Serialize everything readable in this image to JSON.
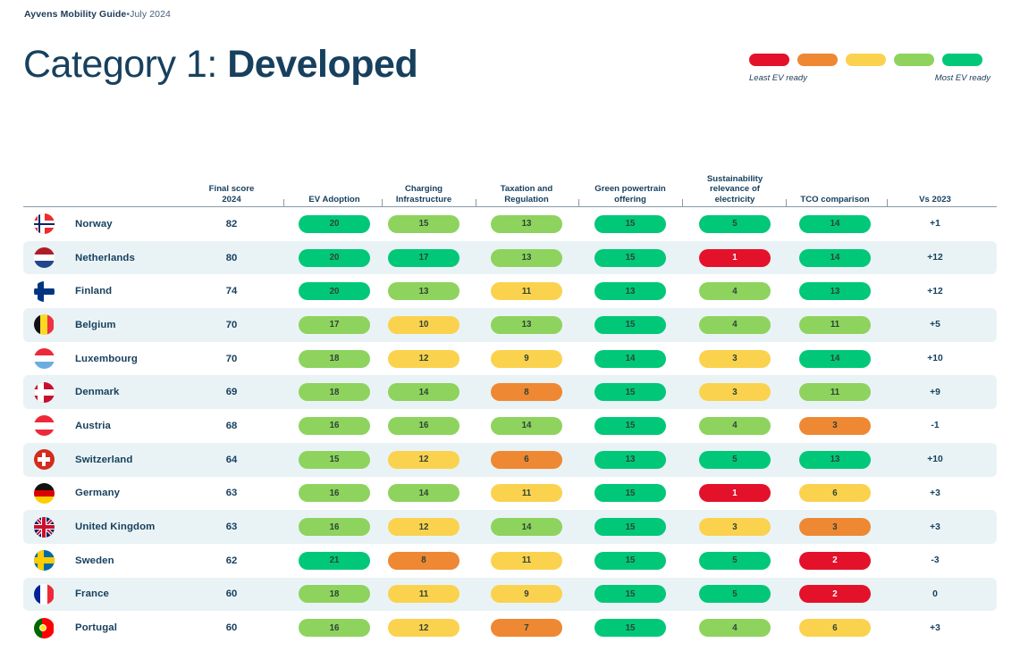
{
  "header": {
    "kicker_brand": "Ayvens Mobility Guide",
    "kicker_sep": "•",
    "kicker_date": "July 2024",
    "title_light": "Category 1:",
    "title_bold": "Developed"
  },
  "legend": {
    "left_label": "Least EV ready",
    "right_label": "Most EV ready",
    "swatches": [
      "#E4112B",
      "#EE8833",
      "#FAD24E",
      "#8DD35E",
      "#00C878"
    ]
  },
  "palette": {
    "red": "#E4112B",
    "orange": "#EE8833",
    "yellow": "#FAD24E",
    "light_green": "#8DD35E",
    "green": "#00C878",
    "row_alt": "#E9F3F5",
    "ink": "#17405E"
  },
  "table": {
    "columns": [
      {
        "label": "Final score\n2024",
        "key": "final_score"
      },
      {
        "label": "EV Adoption",
        "key": "ev_adoption"
      },
      {
        "label": "Charging\nInfrastructure",
        "key": "charging"
      },
      {
        "label": "Taxation and\nRegulation",
        "key": "taxation"
      },
      {
        "label": "Green powertrain\noffering",
        "key": "green_powertrain"
      },
      {
        "label": "Sustainability\nrelevance of\nelectricity",
        "key": "sustainability"
      },
      {
        "label": "TCO comparison",
        "key": "tco"
      },
      {
        "label": "Vs 2023",
        "key": "vs_2023"
      }
    ],
    "rows": [
      {
        "country": "Norway",
        "flag": "no",
        "final_score": "82",
        "cells": [
          {
            "v": "20",
            "c": "green"
          },
          {
            "v": "15",
            "c": "light_green"
          },
          {
            "v": "13",
            "c": "light_green"
          },
          {
            "v": "15",
            "c": "green"
          },
          {
            "v": "5",
            "c": "green"
          },
          {
            "v": "14",
            "c": "green"
          }
        ],
        "vs_2023": "+1"
      },
      {
        "country": "Netherlands",
        "flag": "nl",
        "final_score": "80",
        "cells": [
          {
            "v": "20",
            "c": "green"
          },
          {
            "v": "17",
            "c": "green"
          },
          {
            "v": "13",
            "c": "light_green"
          },
          {
            "v": "15",
            "c": "green"
          },
          {
            "v": "1",
            "c": "red"
          },
          {
            "v": "14",
            "c": "green"
          }
        ],
        "vs_2023": "+12"
      },
      {
        "country": "Finland",
        "flag": "fi",
        "final_score": "74",
        "cells": [
          {
            "v": "20",
            "c": "green"
          },
          {
            "v": "13",
            "c": "light_green"
          },
          {
            "v": "11",
            "c": "yellow"
          },
          {
            "v": "13",
            "c": "green"
          },
          {
            "v": "4",
            "c": "light_green"
          },
          {
            "v": "13",
            "c": "green"
          }
        ],
        "vs_2023": "+12"
      },
      {
        "country": "Belgium",
        "flag": "be",
        "final_score": "70",
        "cells": [
          {
            "v": "17",
            "c": "light_green"
          },
          {
            "v": "10",
            "c": "yellow"
          },
          {
            "v": "13",
            "c": "light_green"
          },
          {
            "v": "15",
            "c": "green"
          },
          {
            "v": "4",
            "c": "light_green"
          },
          {
            "v": "11",
            "c": "light_green"
          }
        ],
        "vs_2023": "+5"
      },
      {
        "country": "Luxembourg",
        "flag": "lu",
        "final_score": "70",
        "cells": [
          {
            "v": "18",
            "c": "light_green"
          },
          {
            "v": "12",
            "c": "yellow"
          },
          {
            "v": "9",
            "c": "yellow"
          },
          {
            "v": "14",
            "c": "green"
          },
          {
            "v": "3",
            "c": "yellow"
          },
          {
            "v": "14",
            "c": "green"
          }
        ],
        "vs_2023": "+10"
      },
      {
        "country": "Denmark",
        "flag": "dk",
        "final_score": "69",
        "cells": [
          {
            "v": "18",
            "c": "light_green"
          },
          {
            "v": "14",
            "c": "light_green"
          },
          {
            "v": "8",
            "c": "orange"
          },
          {
            "v": "15",
            "c": "green"
          },
          {
            "v": "3",
            "c": "yellow"
          },
          {
            "v": "11",
            "c": "light_green"
          }
        ],
        "vs_2023": "+9"
      },
      {
        "country": "Austria",
        "flag": "at",
        "final_score": "68",
        "cells": [
          {
            "v": "16",
            "c": "light_green"
          },
          {
            "v": "16",
            "c": "light_green"
          },
          {
            "v": "14",
            "c": "light_green"
          },
          {
            "v": "15",
            "c": "green"
          },
          {
            "v": "4",
            "c": "light_green"
          },
          {
            "v": "3",
            "c": "orange"
          }
        ],
        "vs_2023": "-1"
      },
      {
        "country": "Switzerland",
        "flag": "ch",
        "final_score": "64",
        "cells": [
          {
            "v": "15",
            "c": "light_green"
          },
          {
            "v": "12",
            "c": "yellow"
          },
          {
            "v": "6",
            "c": "orange"
          },
          {
            "v": "13",
            "c": "green"
          },
          {
            "v": "5",
            "c": "green"
          },
          {
            "v": "13",
            "c": "green"
          }
        ],
        "vs_2023": "+10"
      },
      {
        "country": "Germany",
        "flag": "de",
        "final_score": "63",
        "cells": [
          {
            "v": "16",
            "c": "light_green"
          },
          {
            "v": "14",
            "c": "light_green"
          },
          {
            "v": "11",
            "c": "yellow"
          },
          {
            "v": "15",
            "c": "green"
          },
          {
            "v": "1",
            "c": "red"
          },
          {
            "v": "6",
            "c": "yellow"
          }
        ],
        "vs_2023": "+3"
      },
      {
        "country": "United Kingdom",
        "flag": "gb",
        "final_score": "63",
        "cells": [
          {
            "v": "16",
            "c": "light_green"
          },
          {
            "v": "12",
            "c": "yellow"
          },
          {
            "v": "14",
            "c": "light_green"
          },
          {
            "v": "15",
            "c": "green"
          },
          {
            "v": "3",
            "c": "yellow"
          },
          {
            "v": "3",
            "c": "orange"
          }
        ],
        "vs_2023": "+3"
      },
      {
        "country": "Sweden",
        "flag": "se",
        "final_score": "62",
        "cells": [
          {
            "v": "21",
            "c": "green"
          },
          {
            "v": "8",
            "c": "orange"
          },
          {
            "v": "11",
            "c": "yellow"
          },
          {
            "v": "15",
            "c": "green"
          },
          {
            "v": "5",
            "c": "green"
          },
          {
            "v": "2",
            "c": "red"
          }
        ],
        "vs_2023": "-3"
      },
      {
        "country": "France",
        "flag": "fr",
        "final_score": "60",
        "cells": [
          {
            "v": "18",
            "c": "light_green"
          },
          {
            "v": "11",
            "c": "yellow"
          },
          {
            "v": "9",
            "c": "yellow"
          },
          {
            "v": "15",
            "c": "green"
          },
          {
            "v": "5",
            "c": "green"
          },
          {
            "v": "2",
            "c": "red"
          }
        ],
        "vs_2023": "0"
      },
      {
        "country": "Portugal",
        "flag": "pt",
        "final_score": "60",
        "cells": [
          {
            "v": "16",
            "c": "light_green"
          },
          {
            "v": "12",
            "c": "yellow"
          },
          {
            "v": "7",
            "c": "orange"
          },
          {
            "v": "15",
            "c": "green"
          },
          {
            "v": "4",
            "c": "light_green"
          },
          {
            "v": "6",
            "c": "yellow"
          }
        ],
        "vs_2023": "+3"
      }
    ]
  }
}
